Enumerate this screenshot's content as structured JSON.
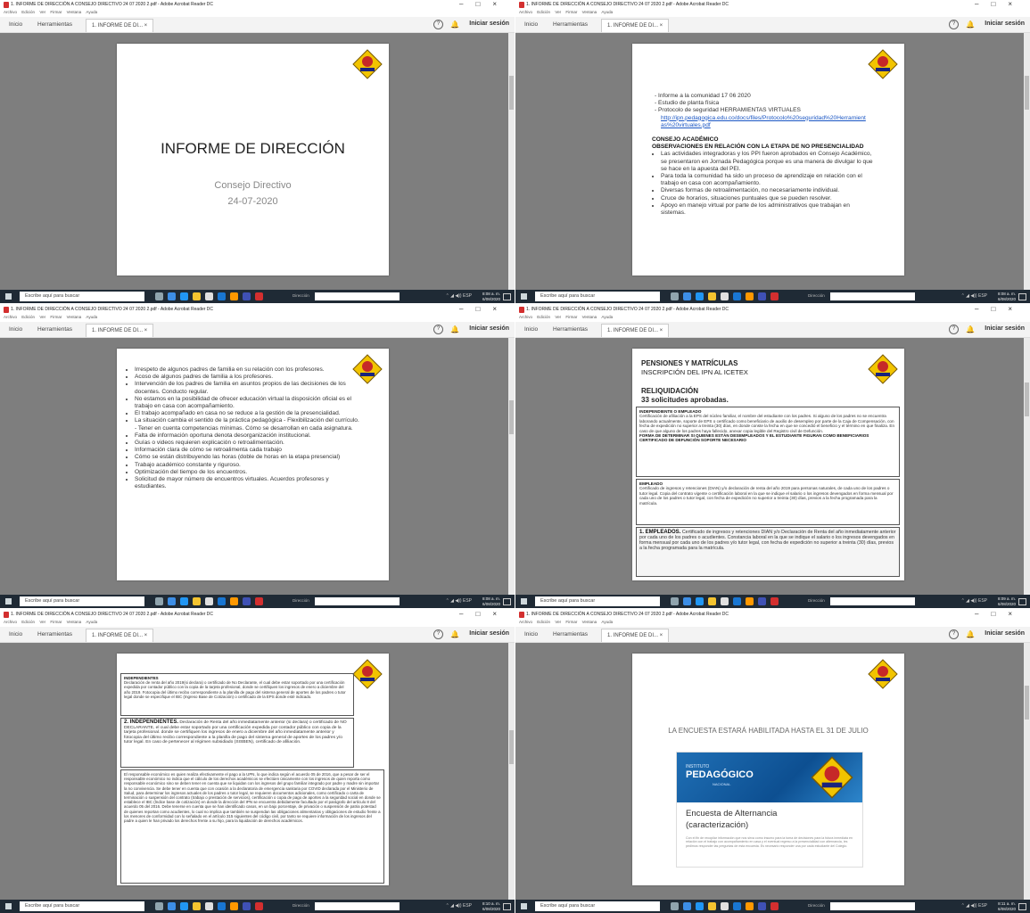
{
  "window": {
    "title": "1. INFORME DE DIRECCIÓN A CONSEJO DIRECTIVO 24 07 2020 2.pdf - Adobe Acrobat Reader DC",
    "menu": [
      "Archivo",
      "Edición",
      "Ver",
      "Firmar",
      "Ventana",
      "Ayuda"
    ],
    "tabs": {
      "home": "Inicio",
      "tools": "Herramientas",
      "doc": "1. INFORME DE DI...  ×"
    },
    "signin": "Iniciar sesión",
    "help": "?"
  },
  "taskbar": {
    "search_placeholder": "Escribe aquí para buscar",
    "address_label": "Dirección",
    "language": "ESP",
    "times": [
      "8:08 a. m.",
      "8:08 a. m.",
      "8:08 a. m.",
      "8:09 a. m.",
      "8:10 a. m.",
      "8:11 a. m."
    ],
    "date": "6/08/2020"
  },
  "logo_text": "LAURENVIS",
  "slide1": {
    "title": "INFORME DE DIRECCIÓN",
    "subtitle": "Consejo Directivo",
    "date": "24-07-2020"
  },
  "slide2": {
    "items": [
      "Informe a la comunidad 17 06 2020",
      "Estudio de planta física",
      "Protocolo de seguridad HERRAMIENTAS VIRTUALES"
    ],
    "link": "http://ipn.pedagogica.edu.co/docs/files/Protocolo%20seguridad%20Herramientas%20virtuales.pdf",
    "heading1": "CONSEJO ACADÉMICO",
    "heading2": "OBSERVACIONES EN RELACIÓN CON LA ETAPA DE NO PRESENCIALIDAD",
    "bullets": [
      "Las actividades integradoras y los PPI fueron aprobados en Consejo Académico, se presentaron en Jornada Pedagógica porque es una manera de divulgar lo que se hace en la apuesta del PEI.",
      "Para toda la comunidad ha sido un proceso de aprendizaje en relación con el trabajo en casa con acompañamiento.",
      "Diversas formas de retroalimentación, no necesariamente individual.",
      "Cruce de horarios, situaciones puntuales que se pueden resolver.",
      "Apoyo en manejo virtual por parte de los administrativos que trabajan en sistemas."
    ]
  },
  "slide3": {
    "bullets": [
      "Irrespeto de algunos padres de familia en su relación con los profesores.",
      "Acoso de algunos padres de familia a los profesores.",
      "Intervención de los padres de familia en asuntos propios de las decisiones de los docentes. Conducto regular.",
      "No estamos en la posibilidad de ofrecer educación virtual la disposición oficial es el trabajo en casa con acompañamiento.",
      "El trabajo acompañado en casa no se reduce a la gestión de la presencialidad.",
      "La situación cambia el sentido de la práctica pedagógica - Flexibilización del currículo. - Tener en cuenta competencias mínimas. Cómo se desarrollan en cada asignatura.",
      "Falta de información oportuna denota desorganización institucional.",
      "Guías o videos requieren explicación o retroalimentación.",
      "Información clara de cómo se retroalimenta cada trabajo",
      "Cómo se están distribuyendo las horas (doble de horas en la etapa presencial)",
      "Trabajo académico constante y riguroso.",
      "Optimización del tiempo de los encuentros.",
      "Solicitud de mayor número de encuentros virtuales. Acuerdos profesores y estudiantes."
    ]
  },
  "slide4": {
    "title": "PENSIONES Y MATRÍCULAS",
    "subtitle": "INSCRIPCIÓN DEL IPN AL ICETEX",
    "reliq": "RELIQUIDACIÓN",
    "count": "33 solicitudes aprobadas.",
    "box1_title": "INDEPENDIENTE O EMPLEADO",
    "box1_text": "Certificación de afiliación a la EPS del núcleo familiar, el nombre del estudiante con los padres. Si alguno de los padres no se encuentra laborando actualmente, soporte de EPS o certificado como beneficiario de auxilio de desempleo por parte de la Caja de Compensación, con fecha de expedición no superior a treinta (30) días, en donde conste la fecha en que se concedió el beneficio y el término en que finaliza. En caso de que alguno de los padres haya fallecido, anexar copia legible del Registro civil de Defunción.",
    "box1_bold": "FORMA DE DETERMINAR SI QUIENES ESTÁN DESEMPLEADOS Y EL ESTUDIANTE FIGURAN COMO BENEFICIARIOS CERTIFICADO DE DEFUNCIÓN SOPORTE NECESARIO",
    "box2_title": "EMPLEADO",
    "box2_text": "Certificado de ingresos y retenciones (DIAN) y/o declaración de renta del año 2019 para personas naturales, de cada uno de los padres o tutor legal. Copia del contrato vigente o certificación laboral en la que se indique el salario o los ingresos devengados en forma mensual por cada uno de los padres o tutor legal, con fecha de expedición no superior a treinta (30) días, previos a la fecha programada para la matrícula.",
    "box3_label": "1.  EMPLEADOS.",
    "box3_text": "Certificado de ingresos y retenciones DIAN y/o Declaración de Renta del año inmediatamente anterior por cada uno de los padres o acudientes. Constancia laboral en la que se indique el salario o los ingresos devengados en forma mensual por cada uno de los padres y/o tutor legal, con fecha de expedición no superior a treinta (30) días, previos a la fecha programada para la matrícula."
  },
  "slide5": {
    "box1_title": "INDEPENDIENTES",
    "box1_text": "Declaración de renta del año 2019(si declara) o certificado de No Declarante, el cual debe estar soportado por una certificación expedida por contador público con la copia de la tarjeta profesional, donde se certifiquen los ingresos de enero a diciembre del año 2019. Fotocopia del último recibo correspondiente a la planilla de pago del sistema general de aportes de los padres o tutor legal donde se especifique el IBC (Ingreso Base de Cotización) o certificado de la EPS donde esté indicado.",
    "box2_label": "2.  INDEPENDIENTES.",
    "box2_text": "Declaración de Renta del año inmediatamente anterior (si declara) o certificado de NO DECLARANTE, el cual debe estar soportado por una certificación expedida por contador público con copia de la tarjeta profesional. donde se certifiquen los ingresos de enero a diciembre del año inmediatamente anterior y fotocopia del último recibo correspondiente a la planilla de pago del sistema general de aportes de los padres y/o tutor legal. En caso de pertenecer al régimen subsidiado (SISBEN), certificado de afiliación.",
    "box3_text": "El responsable económico es quien realiza efectivamente el pago a la UPN, lo que indica según el acuerdo 05 de 2016, que a pesar de ser el responsable económico no indica que el cálculo de los derechos académicos se efectúen únicamente con los ingresos de quien reporta como responsable económico sino se deben tener en cuenta que se liquidan con los ingresos del grupo familiar integrado por padre y madre sin importar la no convivencia. Se debe tener en cuenta que con ocasión a la declaratoria de emergencia sanitaria por COVID declarada por el Ministerio de Salud, para determinar los ingresos actuales de los padres o tutor legal, se requieren documentos adicionales, como certificado o carta de terminación o suspensión del contrato (trabajo o prestación de servicios), certificación o copia de pago de aportes a la seguridad social en donde se establece el IBC (Índice base de cotización) en donde la dirección del IPN se encuentra debidamente facultado por el parágrafo del artículo 8 del acuerdo 05 del 2016. Debe tenerse en cuenta que se han identificado casos, en un bajo porcentaje, de privación o suspensión de patria potestad de quienes reportan como acudientes, lo cual no implica que también se suspendan las obligaciones alimentarias y obligaciones de estudio frente a los menores de conformidad con lo señalado en el artículo 315 siguientes del código civil, por tanto se requiere información de los ingresos del padre a quien le han privado los derechos frente a su hijo, para la liquidación de derechos académicos."
  },
  "slide6": {
    "heading": "LA ENCUESTA ESTARÁ HABILITADA HASTA EL 31 DE JULIO",
    "brand_small": "INSTITUTO",
    "brand_big": "PEDAGÓGICO",
    "brand_sub": "NACIONAL",
    "card_title": "Encuesta de Alternancia",
    "card_sub": "(caracterización)",
    "card_desc": "Con el fin de recopilar información que nos sirva como insumo para la toma de decisiones para la futura inmediata en relación con el trabajo con acompañamiento en casa y el eventual regreso a la presencialidad con alternancia, les pedimos responder las preguntas de esta encuesta. Es necesario responder una por cada estudiante del Colegio."
  },
  "colors": {
    "doc_bg": "#7e7e7e",
    "taskbar": "#1f2a35",
    "link": "#1a56c4",
    "accent": "#d32f2f"
  }
}
